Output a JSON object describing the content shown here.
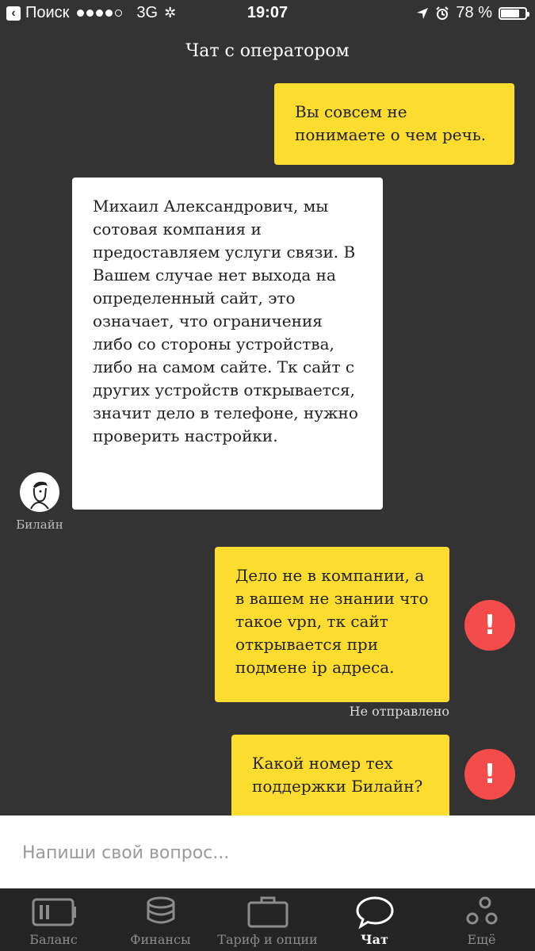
{
  "status_bar": {
    "back_label": "Поиск",
    "network": "3G",
    "time": "19:07",
    "battery": "78 %",
    "battery_level": 0.78
  },
  "header": {
    "title": "Чат с оператором"
  },
  "messages": [
    {
      "from": "user",
      "text": "Вы совсем не понимаете о чем речь."
    },
    {
      "from": "operator",
      "text": "Михаил Александрович, мы сотовая компания и предоставляем услуги связи. В Вашем случае нет выхода на определенный сайт, это означает, что ограничения либо со стороны устройства, либо на самом сайте. Тк сайт с других устройств открывается, значит дело в телефоне, нужно проверить настройки."
    },
    {
      "from": "user",
      "text": "Дело не в компании, а в вашем не знании что такое vpn, тк сайт открывается при подмене ip адреса.",
      "status": "Не отправлено"
    },
    {
      "from": "user",
      "text": "Какой номер тех поддержки Билайн?"
    }
  ],
  "operator_name": "Билайн",
  "error_icon_text": "!",
  "input": {
    "placeholder": "Напиши свой вопрос..."
  },
  "tabs": [
    {
      "label": "Баланс",
      "icon": "battery-icon"
    },
    {
      "label": "Финансы",
      "icon": "coins-icon"
    },
    {
      "label": "Тариф и опции",
      "icon": "briefcase-icon"
    },
    {
      "label": "Чат",
      "icon": "chat-bubble-icon",
      "active": true
    },
    {
      "label": "Ещё",
      "icon": "more-circles-icon"
    }
  ],
  "colors": {
    "background": "#333333",
    "user_bubble": "#fcdc2e",
    "operator_bubble": "#ffffff",
    "error": "#f44b4b",
    "tabbar": "#242424"
  }
}
